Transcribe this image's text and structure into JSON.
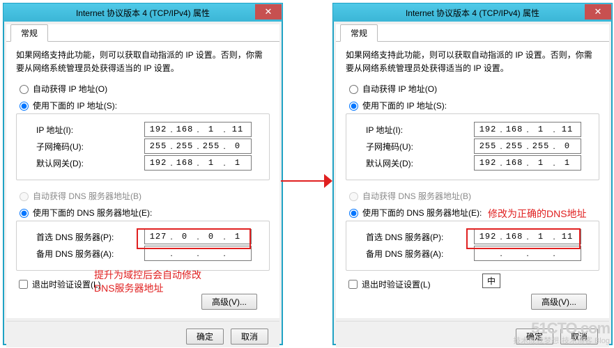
{
  "window_title": "Internet 协议版本 4 (TCP/IPv4) 属性",
  "tab_general": "常规",
  "desc": "如果网络支持此功能，则可以获取自动指派的 IP 设置。否则，你需要从网络系统管理员处获得适当的 IP 设置。",
  "radio_auto_ip": "自动获得 IP 地址(O)",
  "radio_manual_ip": "使用下面的 IP 地址(S):",
  "lbl_ip": "IP 地址(I):",
  "lbl_mask": "子网掩码(U):",
  "lbl_gw": "默认网关(D):",
  "radio_auto_dns": "自动获得 DNS 服务器地址(B)",
  "radio_manual_dns": "使用下面的 DNS 服务器地址(E):",
  "lbl_dns1": "首选 DNS 服务器(P):",
  "lbl_dns2": "备用 DNS 服务器(A):",
  "cb_validate": "退出时验证设置(L)",
  "btn_adv": "高级(V)...",
  "btn_ok": "确定",
  "btn_cancel": "取消",
  "left": {
    "ip": [
      "192",
      "168",
      "1",
      "11"
    ],
    "mask": [
      "255",
      "255",
      "255",
      "0"
    ],
    "gw": [
      "192",
      "168",
      "1",
      "1"
    ],
    "dns1": [
      "127",
      "0",
      "0",
      "1"
    ],
    "dns2": [
      "",
      "",
      "",
      ""
    ],
    "anno": "提升为域控后会自动修改\nDNS服务器地址"
  },
  "right": {
    "ip": [
      "192",
      "168",
      "1",
      "11"
    ],
    "mask": [
      "255",
      "255",
      "255",
      "0"
    ],
    "gw": [
      "192",
      "168",
      "1",
      "1"
    ],
    "dns1": [
      "192",
      "168",
      "1",
      "11"
    ],
    "dns2": [
      "",
      "",
      "",
      ""
    ],
    "anno": "修改为正确的DNS地址",
    "ime": "中"
  },
  "watermark": {
    "host": "51CTO.com",
    "tag": "技术成就梦想·技术博客 Blog"
  }
}
